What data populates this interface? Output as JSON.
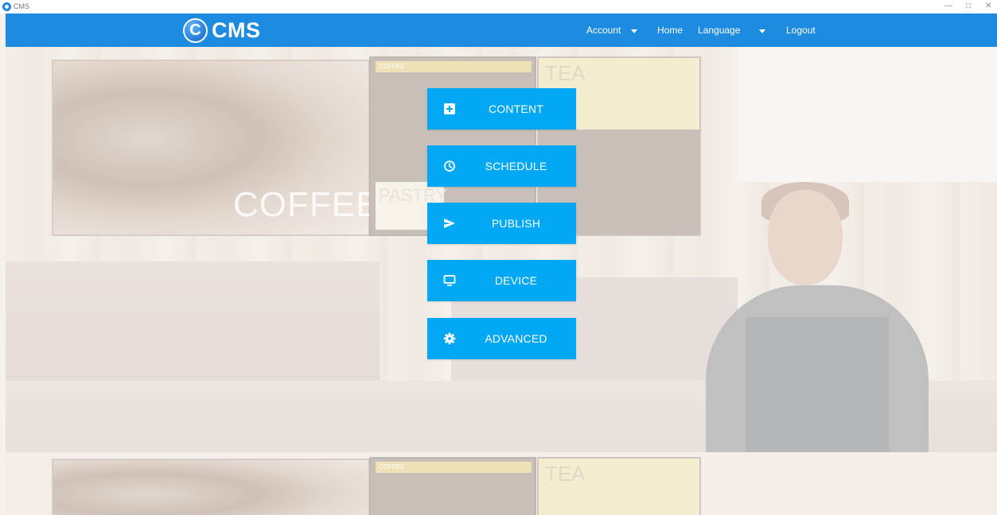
{
  "window": {
    "title": "CMS",
    "minimize": "—",
    "maximize": "□",
    "close": "✕"
  },
  "navbar": {
    "logo_letter": "C",
    "logo_text": "CMS",
    "items": [
      {
        "label": "Account",
        "has_dropdown": true
      },
      {
        "label": "Home",
        "has_dropdown": false
      },
      {
        "label": "Language",
        "has_dropdown": true
      },
      {
        "label": "Logout",
        "has_dropdown": false
      }
    ],
    "background": "#1d8be0"
  },
  "background_image": {
    "poster_word": "COFFEE",
    "board_header": "COFFEE",
    "tea_word": "TEA",
    "pastry_word": "PASTRY"
  },
  "menu": {
    "accent": "#02a8f3",
    "buttons": [
      {
        "label": "CONTENT",
        "icon": "plus-box-icon"
      },
      {
        "label": "SCHEDULE",
        "icon": "clock-icon"
      },
      {
        "label": "PUBLISH",
        "icon": "send-icon"
      },
      {
        "label": "DEVICE",
        "icon": "monitor-icon"
      },
      {
        "label": "ADVANCED",
        "icon": "gear-icon"
      }
    ]
  }
}
